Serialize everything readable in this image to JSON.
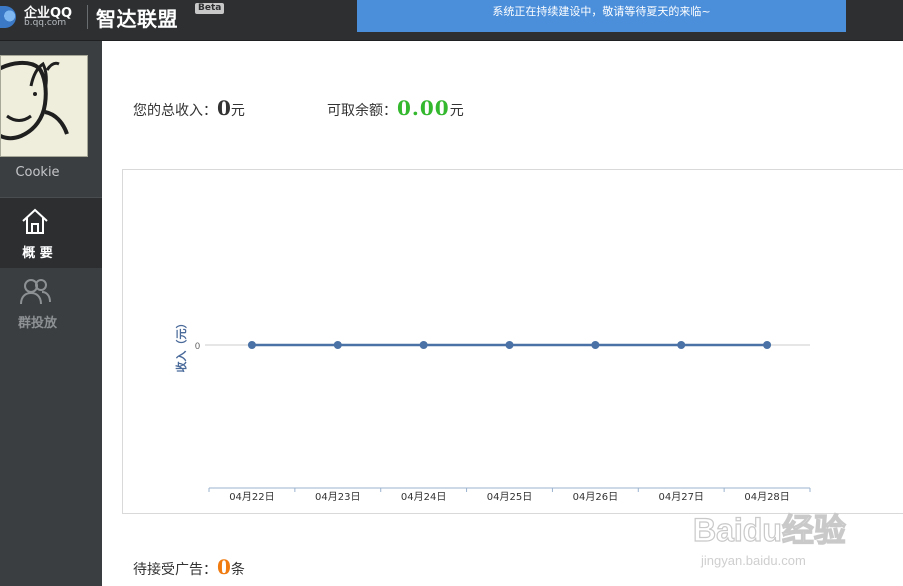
{
  "header": {
    "logo_name": "企业QQ",
    "logo_domain": "b.qq.com",
    "app_title": "智达联盟",
    "beta_tag": "Beta",
    "notice": "系统正在持续建设中，敬请等待夏天的来临~"
  },
  "sidebar": {
    "user_name": "Cookie",
    "items": [
      {
        "label": "概 要",
        "icon": "home-icon",
        "active": true
      },
      {
        "label": "群投放",
        "icon": "users-icon",
        "active": false
      }
    ]
  },
  "summary": {
    "total_income_label": "您的总收入：",
    "total_income_value": "0",
    "total_income_unit": "元",
    "available_label": "可取余额：",
    "available_value": "0.00",
    "available_unit": "元"
  },
  "chart_data": {
    "type": "line",
    "ylabel": "收入（元）",
    "categories": [
      "04月22日",
      "04月23日",
      "04月24日",
      "04月25日",
      "04月26日",
      "04月27日",
      "04月28日"
    ],
    "series": [
      {
        "values": [
          0,
          0,
          0,
          0,
          0,
          0,
          0
        ]
      }
    ],
    "y_ticks": [
      "0"
    ],
    "grid": false,
    "color": "#4a72a6"
  },
  "pending": {
    "label": "待接受广告：",
    "value": "0",
    "unit": "条"
  },
  "watermark": {
    "brand": "Baidu经验",
    "url": "jingyan.baidu.com"
  },
  "colors": {
    "green": "#33b82e",
    "orange": "#f07b10",
    "dark": "#333333"
  }
}
